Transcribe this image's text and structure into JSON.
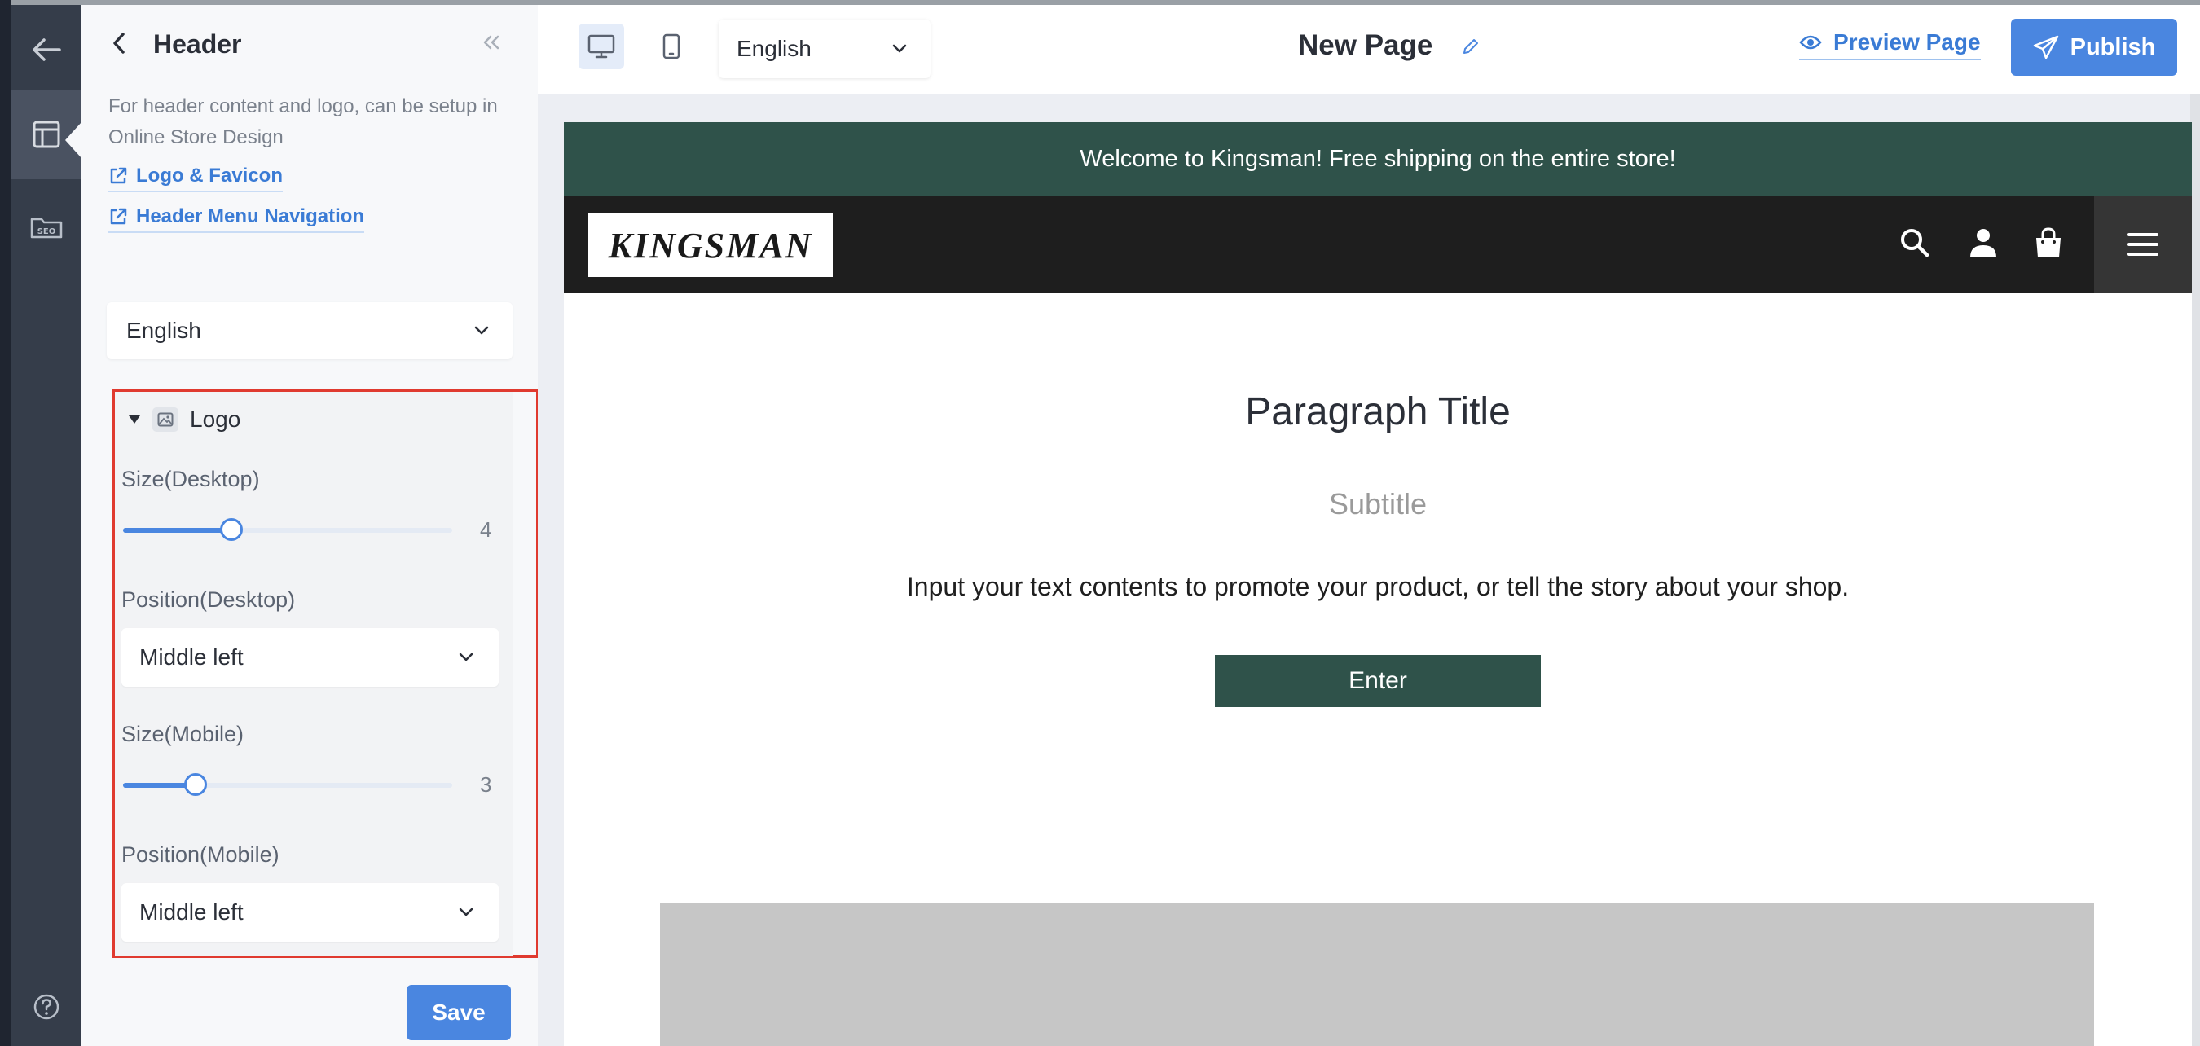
{
  "rail": {
    "back_icon": "arrow-left-icon",
    "items": [
      {
        "icon": "layout-icon",
        "active": true
      },
      {
        "icon": "seo-icon",
        "label": "SEO",
        "active": false
      }
    ],
    "help_icon": "help-circle-icon"
  },
  "panel": {
    "title": "Header",
    "description": "For header content and logo, can be setup in Online Store Design",
    "links": [
      {
        "label": "Logo & Favicon"
      },
      {
        "label": "Header Menu Navigation"
      }
    ],
    "language": "English",
    "logo_section": {
      "title": "Logo",
      "size_desktop_label": "Size(Desktop)",
      "size_desktop_value": "4",
      "size_desktop_fraction": 0.33,
      "position_desktop_label": "Position(Desktop)",
      "position_desktop_value": "Middle left",
      "size_mobile_label": "Size(Mobile)",
      "size_mobile_value": "3",
      "size_mobile_fraction": 0.22,
      "position_mobile_label": "Position(Mobile)",
      "position_mobile_value": "Middle left"
    },
    "save_label": "Save"
  },
  "toolbar": {
    "language": "English",
    "page_name": "New Page",
    "preview_label": "Preview Page",
    "publish_label": "Publish"
  },
  "preview": {
    "announcement": "Welcome to Kingsman! Free shipping on the entire store!",
    "store_logo": "KINGSMAN",
    "paragraph_title": "Paragraph Title",
    "subtitle": "Subtitle",
    "body": "Input your text contents to promote your product, or tell the story about your shop.",
    "button_label": "Enter"
  },
  "colors": {
    "accent": "#4a86e0",
    "highlight_border": "#e03a2f",
    "announcement_bg": "#2f524a",
    "nav_bg": "#1e1e1e"
  }
}
